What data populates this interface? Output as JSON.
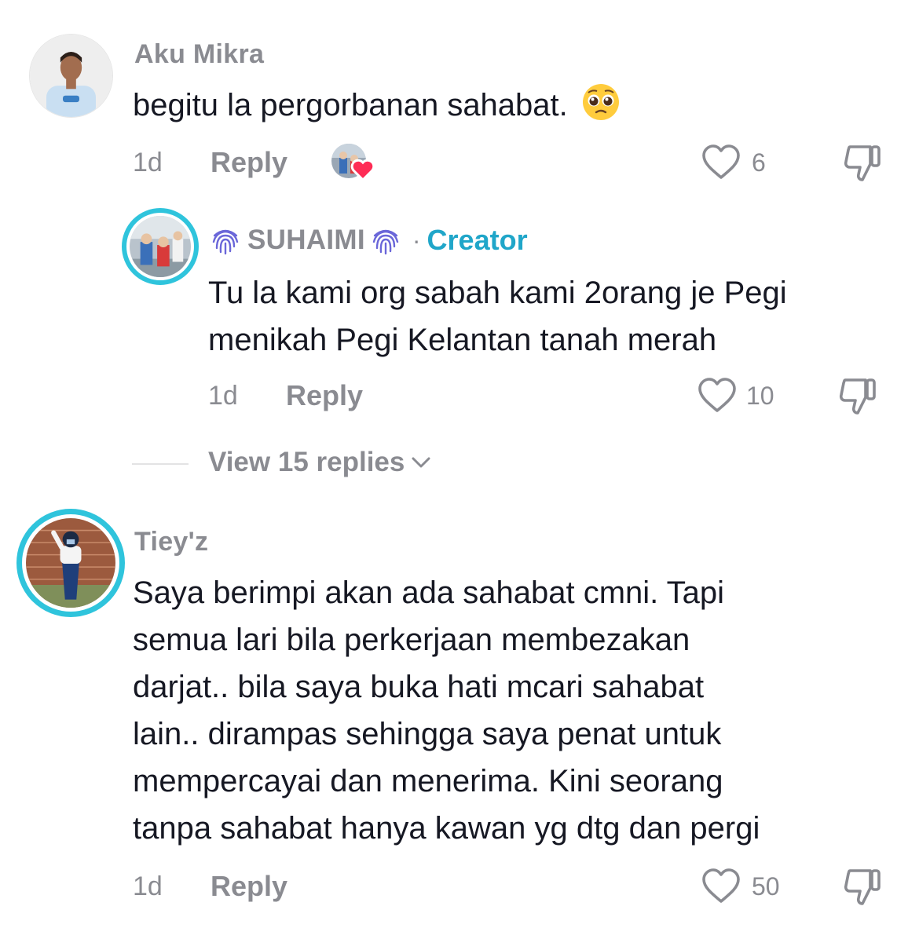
{
  "comments": [
    {
      "username": "Aku Mikra",
      "text": "begitu la pergorbanan sahabat.",
      "emoji": "pleading-face-emoji",
      "time": "1d",
      "reply_label": "Reply",
      "likes": "6",
      "creator_liked": true
    },
    {
      "username": "SUHAIMI",
      "badge": "Creator",
      "separator": "·",
      "text_lines": [
        "Tu la kami org sabah kami 2orang je Pegi",
        "menikah Pegi Kelantan tanah merah"
      ],
      "time": "1d",
      "reply_label": "Reply",
      "likes": "10"
    },
    {
      "username": "Tiey'z",
      "text_lines": [
        "Saya berimpi akan ada sahabat cmni. Tapi",
        "semua lari bila perkerjaan membezakan",
        "darjat.. bila saya buka hati mcari sahabat",
        "lain.. dirampas sehingga saya penat untuk",
        "mempercayai dan menerima. Kini seorang",
        "tanpa sahabat hanya kawan yg dtg dan pergi"
      ],
      "time": "1d",
      "reply_label": "Reply",
      "likes": "50"
    }
  ],
  "view_replies": "View 15 replies",
  "colors": {
    "text": "#161823",
    "muted": "#8a8b91",
    "creator": "#20a6c9",
    "story_ring": "#2fc4dc",
    "heart": "#fe2c55"
  }
}
